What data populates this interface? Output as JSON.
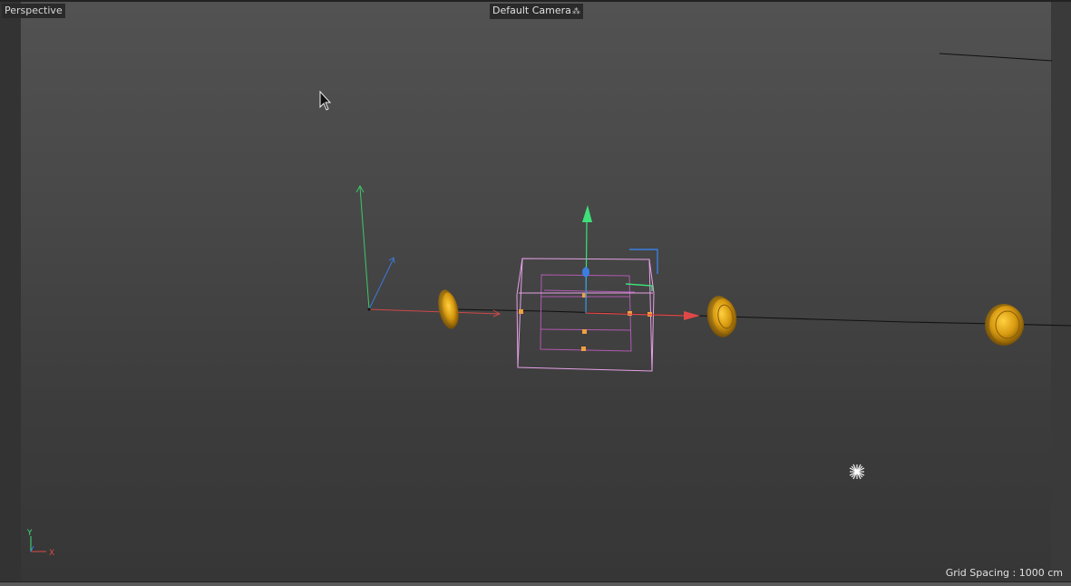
{
  "viewport": {
    "view_name": "Perspective",
    "camera_name": "Default Camera",
    "camera_icon": "camera-options-icon",
    "grid_spacing_text": "Grid Spacing : 1000 cm"
  },
  "axis_indicator": {
    "y_label": "Y",
    "x_label": "X"
  },
  "colors": {
    "x_axis": "#e04848",
    "y_axis": "#3ee07a",
    "z_axis": "#3c7ee0",
    "selection_box": "#e6a0e6",
    "handle": "#f0a040",
    "coin": "#d8a010"
  }
}
